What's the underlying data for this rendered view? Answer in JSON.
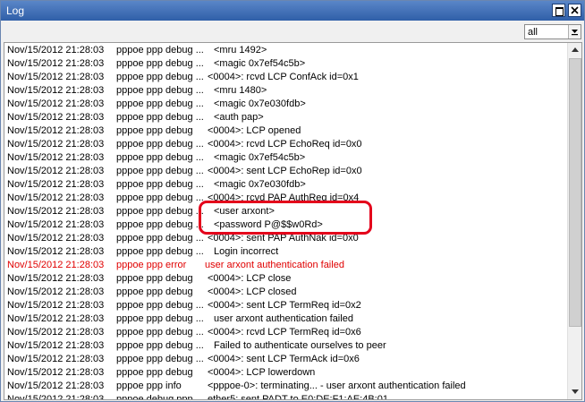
{
  "window": {
    "title": "Log"
  },
  "toolbar": {
    "filter_value": "all"
  },
  "log": {
    "rows": [
      {
        "time": "Nov/15/2012 21:28:03",
        "topic": "pppoe ppp debug ...",
        "msg": "<mru 1492>",
        "indent": 1,
        "error": false
      },
      {
        "time": "Nov/15/2012 21:28:03",
        "topic": "pppoe ppp debug ...",
        "msg": "<magic 0x7ef54c5b>",
        "indent": 1,
        "error": false
      },
      {
        "time": "Nov/15/2012 21:28:03",
        "topic": "pppoe ppp debug ...",
        "msg": "<0004>: rcvd LCP ConfAck id=0x1",
        "indent": 0,
        "error": false
      },
      {
        "time": "Nov/15/2012 21:28:03",
        "topic": "pppoe ppp debug ...",
        "msg": "<mru 1480>",
        "indent": 1,
        "error": false
      },
      {
        "time": "Nov/15/2012 21:28:03",
        "topic": "pppoe ppp debug ...",
        "msg": "<magic 0x7e030fdb>",
        "indent": 1,
        "error": false
      },
      {
        "time": "Nov/15/2012 21:28:03",
        "topic": "pppoe ppp debug ...",
        "msg": "<auth pap>",
        "indent": 1,
        "error": false
      },
      {
        "time": "Nov/15/2012 21:28:03",
        "topic": "pppoe ppp debug",
        "msg": "<0004>: LCP opened",
        "indent": 0,
        "error": false
      },
      {
        "time": "Nov/15/2012 21:28:03",
        "topic": "pppoe ppp debug ...",
        "msg": "<0004>: rcvd LCP EchoReq id=0x0",
        "indent": 0,
        "error": false
      },
      {
        "time": "Nov/15/2012 21:28:03",
        "topic": "pppoe ppp debug ...",
        "msg": "<magic 0x7ef54c5b>",
        "indent": 1,
        "error": false
      },
      {
        "time": "Nov/15/2012 21:28:03",
        "topic": "pppoe ppp debug ...",
        "msg": "<0004>: sent LCP EchoRep id=0x0",
        "indent": 0,
        "error": false
      },
      {
        "time": "Nov/15/2012 21:28:03",
        "topic": "pppoe ppp debug ...",
        "msg": "<magic 0x7e030fdb>",
        "indent": 1,
        "error": false
      },
      {
        "time": "Nov/15/2012 21:28:03",
        "topic": "pppoe ppp debug ...",
        "msg": "<0004>: rcvd PAP AuthReq id=0x4",
        "indent": 0,
        "error": false
      },
      {
        "time": "Nov/15/2012 21:28:03",
        "topic": "pppoe ppp debug ...",
        "msg": "<user arxont>",
        "indent": 1,
        "error": false
      },
      {
        "time": "Nov/15/2012 21:28:03",
        "topic": "pppoe ppp debug ...",
        "msg": "<password P@$$w0Rd>",
        "indent": 1,
        "error": false
      },
      {
        "time": "Nov/15/2012 21:28:03",
        "topic": "pppoe ppp debug ...",
        "msg": "<0004>: sent PAP AuthNak id=0x0",
        "indent": 0,
        "error": false
      },
      {
        "time": "Nov/15/2012 21:28:03",
        "topic": "pppoe ppp debug ...",
        "msg": "Login incorrect",
        "indent": 1,
        "error": false
      },
      {
        "time": "Nov/15/2012 21:28:03",
        "topic": "pppoe ppp error",
        "msg": "user arxont authentication failed",
        "indent": -1,
        "error": true
      },
      {
        "time": "Nov/15/2012 21:28:03",
        "topic": "pppoe ppp debug",
        "msg": "<0004>: LCP close",
        "indent": 0,
        "error": false
      },
      {
        "time": "Nov/15/2012 21:28:03",
        "topic": "pppoe ppp debug",
        "msg": "<0004>: LCP closed",
        "indent": 0,
        "error": false
      },
      {
        "time": "Nov/15/2012 21:28:03",
        "topic": "pppoe ppp debug ...",
        "msg": "<0004>: sent LCP TermReq id=0x2",
        "indent": 0,
        "error": false
      },
      {
        "time": "Nov/15/2012 21:28:03",
        "topic": "pppoe ppp debug ...",
        "msg": "user arxont authentication failed",
        "indent": 1,
        "error": false
      },
      {
        "time": "Nov/15/2012 21:28:03",
        "topic": "pppoe ppp debug ...",
        "msg": "<0004>: rcvd LCP TermReq id=0x6",
        "indent": 0,
        "error": false
      },
      {
        "time": "Nov/15/2012 21:28:03",
        "topic": "pppoe ppp debug ...",
        "msg": "Failed to authenticate ourselves to peer",
        "indent": 1,
        "error": false
      },
      {
        "time": "Nov/15/2012 21:28:03",
        "topic": "pppoe ppp debug ...",
        "msg": "<0004>: sent LCP TermAck id=0x6",
        "indent": 0,
        "error": false
      },
      {
        "time": "Nov/15/2012 21:28:03",
        "topic": "pppoe ppp debug",
        "msg": "<0004>: LCP lowerdown",
        "indent": 0,
        "error": false
      },
      {
        "time": "Nov/15/2012 21:28:03",
        "topic": "pppoe ppp info",
        "msg": "<pppoe-0>: terminating... - user arxont authentication failed",
        "indent": 0,
        "error": false
      },
      {
        "time": "Nov/15/2012 21:28:03",
        "topic": "pppoe debug ppp",
        "msg": "ether5: sent PADT to E0:DE:F1:AE:4B:01",
        "indent": 0,
        "error": false
      }
    ]
  },
  "colors": {
    "error_text": "#e00000",
    "highlight": "#e4001b",
    "title_bar": "#3a6cb5"
  },
  "icons": {
    "maximize": "maximize-icon",
    "close": "close-icon",
    "dropdown": "chevron-down-icon",
    "scroll_up": "arrow-up-icon",
    "scroll_down": "arrow-down-icon"
  }
}
